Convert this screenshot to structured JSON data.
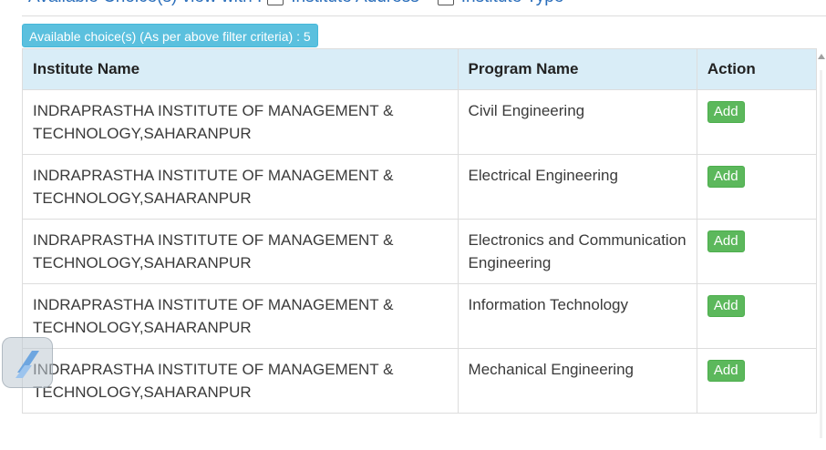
{
  "filter": {
    "label": "Available Choice(s) view with :",
    "options": [
      "Institute Address",
      "Institute Type"
    ]
  },
  "count_badge": "Available choice(s) (As per above filter criteria) : 5",
  "table": {
    "headers": [
      "Institute Name",
      "Program Name",
      "Action"
    ],
    "rows": [
      {
        "institute": "INDRAPRASTHA INSTITUTE OF MANAGEMENT & TECHNOLOGY,SAHARANPUR",
        "program": "Civil Engineering",
        "action": "Add"
      },
      {
        "institute": "INDRAPRASTHA INSTITUTE OF MANAGEMENT & TECHNOLOGY,SAHARANPUR",
        "program": "Electrical Engineering",
        "action": "Add"
      },
      {
        "institute": "INDRAPRASTHA INSTITUTE OF MANAGEMENT & TECHNOLOGY,SAHARANPUR",
        "program": "Electronics and Communication Engineering",
        "action": "Add"
      },
      {
        "institute": "INDRAPRASTHA INSTITUTE OF MANAGEMENT & TECHNOLOGY,SAHARANPUR",
        "program": "Information Technology",
        "action": "Add"
      },
      {
        "institute": "INDRAPRASTHA INSTITUTE OF MANAGEMENT & TECHNOLOGY,SAHARANPUR",
        "program": "Mechanical Engineering",
        "action": "Add"
      }
    ]
  },
  "colors": {
    "header_bg": "#d9edf7",
    "badge_bg": "#5bc0de",
    "add_button": "#5cb85c",
    "filter_text": "#2a6ebb"
  },
  "icons": {
    "floating_widget": "pen-tool-icon",
    "scroll_up": "scroll-up-arrow-icon"
  }
}
